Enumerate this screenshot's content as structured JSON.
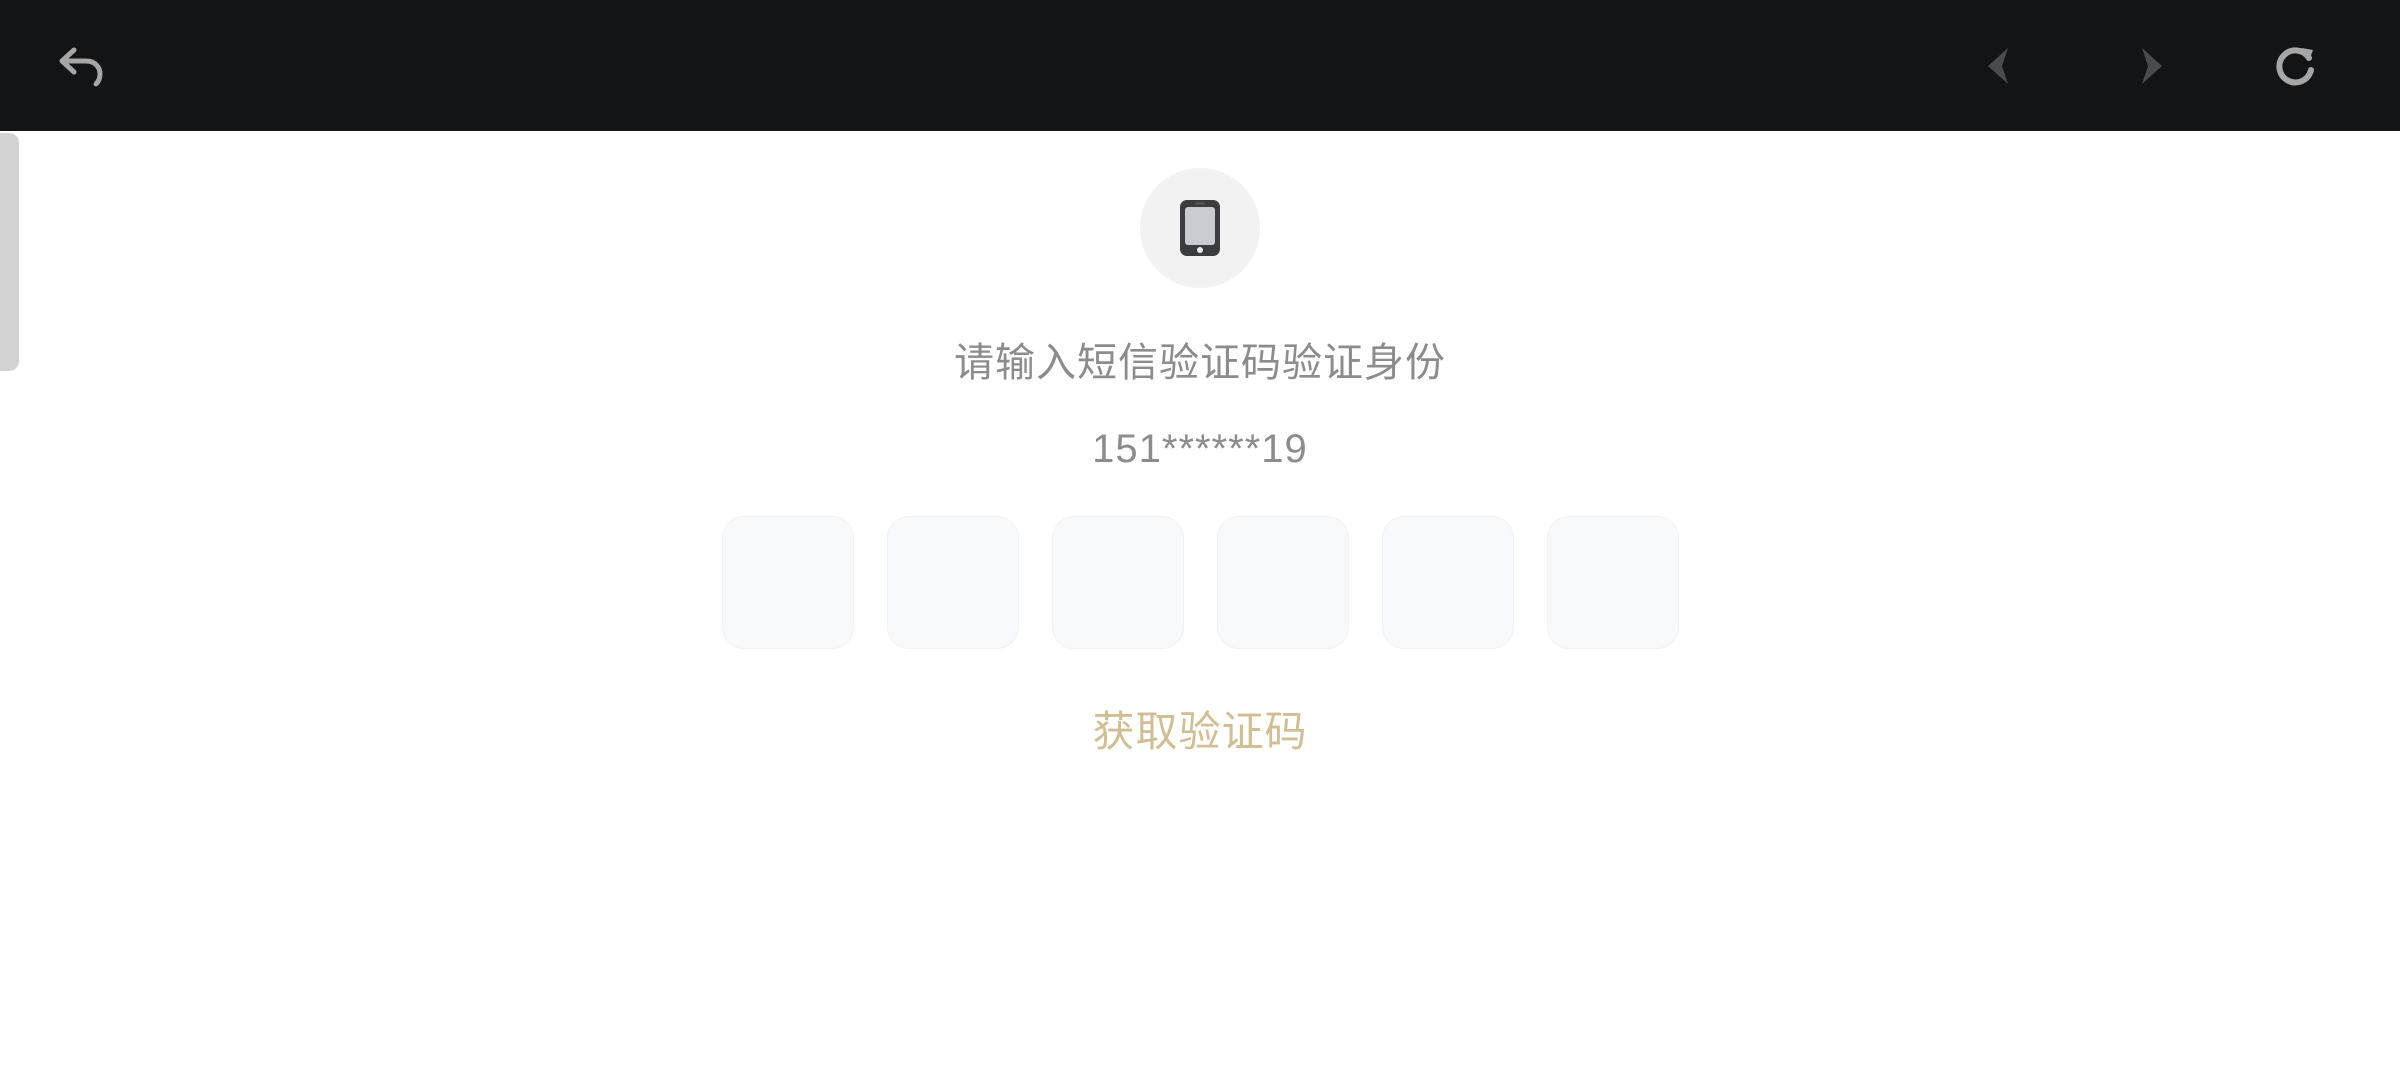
{
  "toolbar": {
    "back_icon": "undo-arrow-icon",
    "prev_icon": "chevron-left-icon",
    "next_icon": "chevron-right-icon",
    "reload_icon": "reload-icon"
  },
  "verification": {
    "icon": "mobile-phone-icon",
    "title": "请输入短信验证码验证身份",
    "phone_number": "151******19",
    "code_boxes": [
      "",
      "",
      "",
      "",
      "",
      ""
    ],
    "get_code_label": "获取验证码"
  },
  "colors": {
    "topbar": "#131416",
    "muted_text": "#8c8c8c",
    "accent_gold": "#d1bf93",
    "code_box_bg": "#f8f9fb"
  }
}
